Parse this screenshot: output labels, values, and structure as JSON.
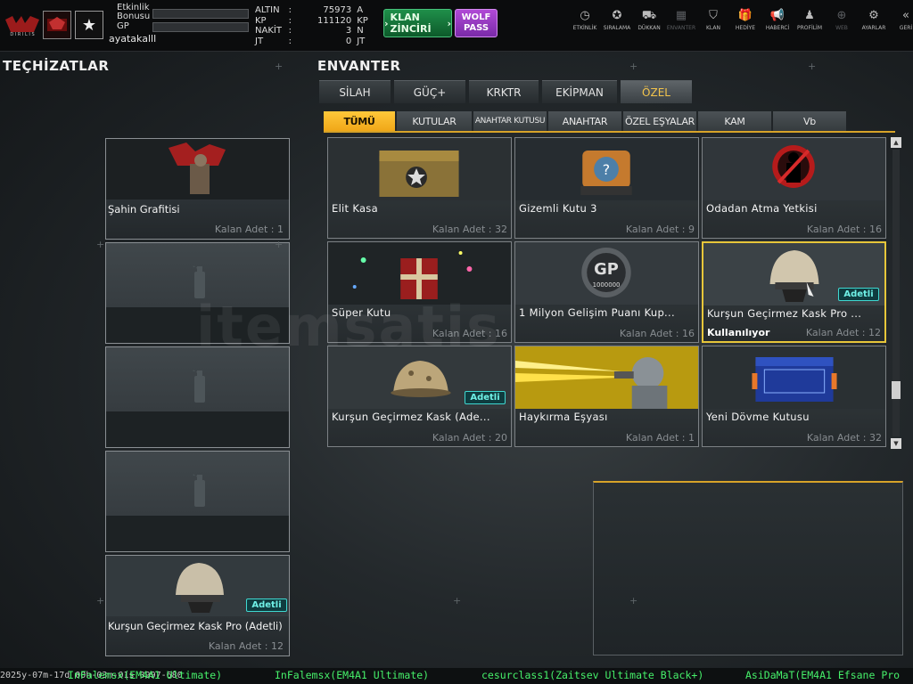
{
  "header": {
    "event_label": "Etkinlik Bonusu",
    "gp_label": "GP",
    "username": "ayatakalll",
    "currency": [
      {
        "label": "ALTIN",
        "sep": ":",
        "value": "75973",
        "unit": "A"
      },
      {
        "label": "KP",
        "sep": ":",
        "value": "111120",
        "unit": "KP"
      },
      {
        "label": "NAKİT",
        "sep": ":",
        "value": "3",
        "unit": "N"
      },
      {
        "label": "JT",
        "sep": ":",
        "value": "0",
        "unit": "JT"
      }
    ],
    "klan_button": "KLAN ZİNCİRİ",
    "wolf_pass_line1": "WOLF",
    "wolf_pass_line2": "PASS",
    "menu": [
      {
        "label": "ETKİNLİK",
        "icon": "stopwatch-icon",
        "glyph": "◷",
        "disabled": false
      },
      {
        "label": "SIRALAMA",
        "icon": "medal-icon",
        "glyph": "✪",
        "disabled": false
      },
      {
        "label": "DÜKKAN",
        "icon": "cart-icon",
        "glyph": "⛟",
        "disabled": false
      },
      {
        "label": "ENVANTER",
        "icon": "inventory-icon",
        "glyph": "▦",
        "disabled": true
      },
      {
        "label": "KLAN",
        "icon": "shield-icon",
        "glyph": "⛉",
        "disabled": false
      },
      {
        "label": "HEDİYE",
        "icon": "gift-icon",
        "glyph": "🎁",
        "disabled": false
      },
      {
        "label": "HABERCİ",
        "icon": "megaphone-icon",
        "glyph": "📢",
        "disabled": false
      },
      {
        "label": "PROFİLİM",
        "icon": "profile-icon",
        "glyph": "♟",
        "disabled": false
      },
      {
        "label": "WEB",
        "icon": "globe-icon",
        "glyph": "⊕",
        "disabled": true
      },
      {
        "label": "AYARLAR",
        "icon": "gear-icon",
        "glyph": "⚙",
        "disabled": false
      },
      {
        "label": "GERİ",
        "icon": "back-chevron-icon",
        "glyph": "«",
        "disabled": false
      }
    ]
  },
  "equipment": {
    "title": "TEÇHİZATLAR",
    "slots": [
      {
        "name": "Şahin Grafitisi",
        "qty": "Kalan Adet : 1",
        "empty": false,
        "badge": ""
      },
      {
        "name": "",
        "qty": "",
        "empty": true,
        "badge": ""
      },
      {
        "name": "",
        "qty": "",
        "empty": true,
        "badge": ""
      },
      {
        "name": "",
        "qty": "",
        "empty": true,
        "badge": ""
      },
      {
        "name": "Kurşun Geçirmez Kask Pro (Adetli)",
        "qty": "Kalan Adet : 12",
        "empty": false,
        "badge": "Adetli"
      }
    ]
  },
  "inventory": {
    "title": "ENVANTER",
    "main_tabs": [
      {
        "label": "SİLAH",
        "active": false
      },
      {
        "label": "GÜÇ+",
        "active": false
      },
      {
        "label": "KRKTR",
        "active": false
      },
      {
        "label": "EKİPMAN",
        "active": false
      },
      {
        "label": "ÖZEL",
        "active": true
      }
    ],
    "sub_tabs": [
      {
        "label": "TÜMÜ",
        "active": true
      },
      {
        "label": "KUTULAR",
        "active": false
      },
      {
        "label": "ANAHTAR KUTUSU",
        "active": false
      },
      {
        "label": "ANAHTAR",
        "active": false
      },
      {
        "label": "ÖZEL EŞYALAR",
        "active": false
      },
      {
        "label": "KAM",
        "active": false
      },
      {
        "label": "Vb",
        "active": false
      }
    ],
    "items": [
      {
        "name": "Elit Kasa",
        "qty": "Kalan Adet : 32",
        "badge": "",
        "status": "",
        "selected": false,
        "art": "crate"
      },
      {
        "name": "Gizemli Kutu 3",
        "qty": "Kalan Adet : 9",
        "badge": "",
        "status": "",
        "selected": false,
        "art": "mystery"
      },
      {
        "name": "Odadan Atma Yetkisi",
        "qty": "Kalan Adet : 16",
        "badge": "",
        "status": "",
        "selected": false,
        "art": "kick"
      },
      {
        "name": "Süper Kutu",
        "qty": "Kalan Adet : 16",
        "badge": "",
        "status": "",
        "selected": false,
        "art": "gift"
      },
      {
        "name": "1 Milyon Gelişim Puanı Kup...",
        "qty": "Kalan Adet : 16",
        "badge": "",
        "status": "",
        "selected": false,
        "art": "gp",
        "coin_top": "GP",
        "coin_bottom": "1000000"
      },
      {
        "name": "Kurşun Geçirmez Kask Pro ...",
        "qty": "Kalan Adet : 12",
        "badge": "Adetli",
        "status": "Kullanılıyor",
        "selected": true,
        "art": "helmet"
      },
      {
        "name": "Kurşun Geçirmez Kask (Ade...",
        "qty": "Kalan Adet : 20",
        "badge": "Adetli",
        "status": "",
        "selected": false,
        "art": "helmet2"
      },
      {
        "name": "Haykırma Eşyası",
        "qty": "Kalan Adet : 1",
        "badge": "",
        "status": "",
        "selected": false,
        "art": "shout"
      },
      {
        "name": "Yeni Dövme Kutusu",
        "qty": "Kalan Adet : 32",
        "badge": "",
        "status": "",
        "selected": false,
        "art": "bluebox"
      }
    ]
  },
  "ticker": [
    {
      "text": "2025y-07m-17d 00h-03m-01s 0997-680",
      "type": "time"
    },
    {
      "text": "InFalemsx(EM4A1 Ultimate)",
      "type": "msg"
    },
    {
      "text": "InFalemsx(EM4A1 Ultimate)",
      "type": "msg"
    },
    {
      "text": "cesurclass1(Zaitsev Ultimate Black+)",
      "type": "msg"
    },
    {
      "text": "AsiDaMaT(EM4A1 Efsane Pro",
      "type": "msg"
    }
  ],
  "watermark": "itemsatis"
}
